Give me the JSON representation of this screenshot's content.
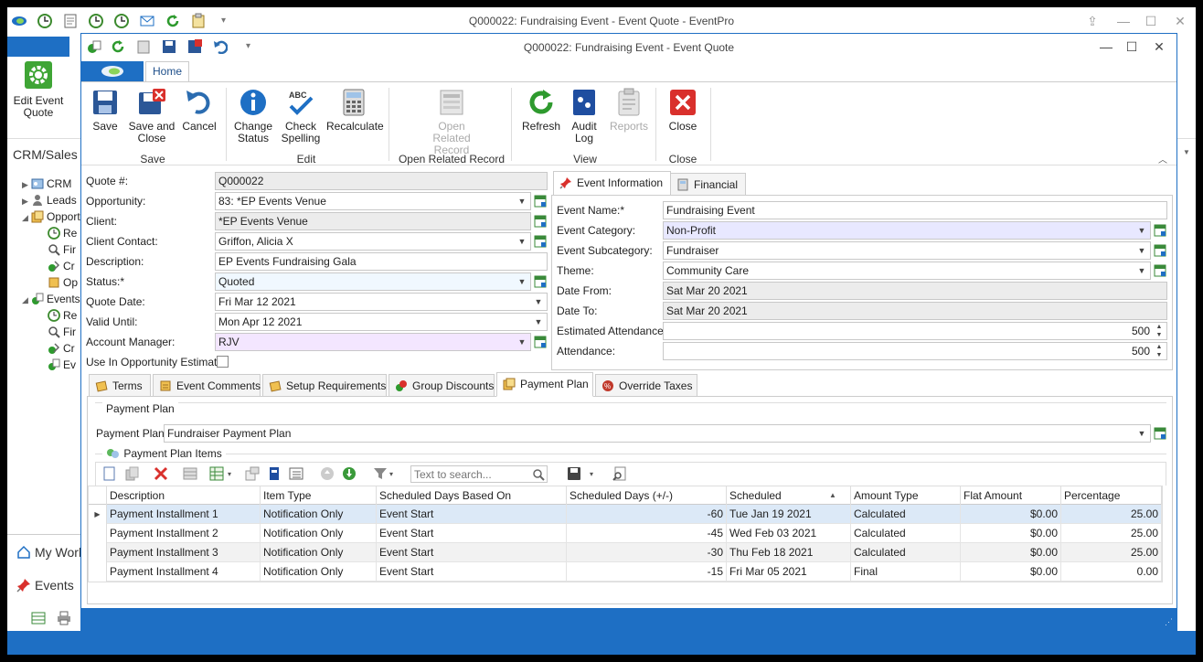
{
  "main_window": {
    "title": "Q000022: Fundraising Event - Event Quote - EventPro",
    "edit_button": "Edit Event Quote",
    "crm_header": "CRM/Sales",
    "tree": [
      {
        "label": "CRM",
        "level": 1,
        "icon": "crm-icon",
        "arrow": "▶"
      },
      {
        "label": "Leads",
        "level": 1,
        "icon": "leads-icon",
        "arrow": "▶"
      },
      {
        "label": "Opportunities",
        "level": 1,
        "icon": "opportunities-icon",
        "arrow": "◢"
      },
      {
        "label": "Re",
        "level": 2,
        "icon": "clock-icon"
      },
      {
        "label": "Fir",
        "level": 2,
        "icon": "search-icon"
      },
      {
        "label": "Cr",
        "level": 2,
        "icon": "create-icon"
      },
      {
        "label": "Op",
        "level": 2,
        "icon": "opportunity-icon"
      },
      {
        "label": "Events",
        "level": 1,
        "icon": "events-icon",
        "arrow": "◢"
      },
      {
        "label": "Re",
        "level": 2,
        "icon": "clock-icon"
      },
      {
        "label": "Fir",
        "level": 2,
        "icon": "search-icon"
      },
      {
        "label": "Cr",
        "level": 2,
        "icon": "create-icon"
      },
      {
        "label": "Ev",
        "level": 2,
        "icon": "event-quote-icon"
      }
    ],
    "nav_bottom": [
      "My Work",
      "Events"
    ]
  },
  "dialog": {
    "title": "Q000022: Fundraising Event - Event Quote",
    "home_tab": "Home",
    "ribbon": {
      "save": "Save",
      "save_close": "Save and Close",
      "cancel": "Cancel",
      "change_status": "Change Status",
      "check_spelling": "Check Spelling",
      "recalculate": "Recalculate",
      "open_related": "Open Related Record",
      "refresh": "Refresh",
      "audit_log": "Audit Log",
      "reports": "Reports",
      "close": "Close",
      "groups": {
        "save": "Save",
        "edit": "Edit",
        "open_related": "Open Related Record",
        "view": "View",
        "close": "Close"
      }
    },
    "form": {
      "quote_no_label": "Quote #:",
      "quote_no": "Q000022",
      "opportunity_label": "Opportunity:",
      "opportunity": "83: *EP Events Venue",
      "client_label": "Client:",
      "client": "*EP Events Venue",
      "client_contact_label": "Client Contact:",
      "client_contact": "Griffon, Alicia X",
      "description_label": "Description:",
      "description": "EP Events Fundraising Gala",
      "status_label": "Status:*",
      "status": "Quoted",
      "quote_date_label": "Quote Date:",
      "quote_date": "Fri Mar 12 2021",
      "valid_until_label": "Valid Until:",
      "valid_until": "Mon Apr 12 2021",
      "account_manager_label": "Account Manager:",
      "account_manager": "RJV",
      "use_in_estimate_label": "Use In Opportunity Estimate"
    },
    "event_tabs": {
      "event_information": "Event Information",
      "financial": "Financial"
    },
    "event_info": {
      "event_name_label": "Event Name:*",
      "event_name": "Fundraising Event",
      "event_category_label": "Event Category:",
      "event_category": "Non-Profit",
      "event_subcategory_label": "Event Subcategory:",
      "event_subcategory": "Fundraiser",
      "theme_label": "Theme:",
      "theme": "Community Care",
      "date_from_label": "Date From:",
      "date_from": "Sat Mar 20 2021",
      "date_to_label": "Date To:",
      "date_to": "Sat Mar 20 2021",
      "est_attendance_label": "Estimated Attendance:",
      "est_attendance": "500",
      "attendance_label": "Attendance:",
      "attendance": "500"
    },
    "lower_tabs": [
      "Terms",
      "Event Comments",
      "Setup Requirements",
      "Group Discounts",
      "Payment Plan",
      "Override Taxes"
    ],
    "payment_plan": {
      "group_title": "Payment Plan",
      "plan_label": "Payment Plan:",
      "plan_value": "Fundraiser Payment Plan",
      "items_title": "Payment Plan Items",
      "search_placeholder": "Text to search...",
      "columns": [
        "Description",
        "Item Type",
        "Scheduled Days Based On",
        "Scheduled Days (+/-)",
        "Scheduled",
        "Amount Type",
        "Flat Amount",
        "Percentage"
      ],
      "rows": [
        [
          "Payment Installment 1",
          "Notification Only",
          "Event Start",
          "-60",
          "Tue Jan 19 2021",
          "Calculated",
          "$0.00",
          "25.00"
        ],
        [
          "Payment Installment 2",
          "Notification Only",
          "Event Start",
          "-45",
          "Wed Feb 03 2021",
          "Calculated",
          "$0.00",
          "25.00"
        ],
        [
          "Payment Installment 3",
          "Notification Only",
          "Event Start",
          "-30",
          "Thu Feb 18 2021",
          "Calculated",
          "$0.00",
          "25.00"
        ],
        [
          "Payment Installment 4",
          "Notification Only",
          "Event Start",
          "-15",
          "Fri Mar 05 2021",
          "Final",
          "$0.00",
          "0.00"
        ]
      ]
    }
  },
  "colors": {
    "accent": "#1e6fc4",
    "selected_row": "#dce9f7",
    "alt_row": "#f2f2f2"
  }
}
